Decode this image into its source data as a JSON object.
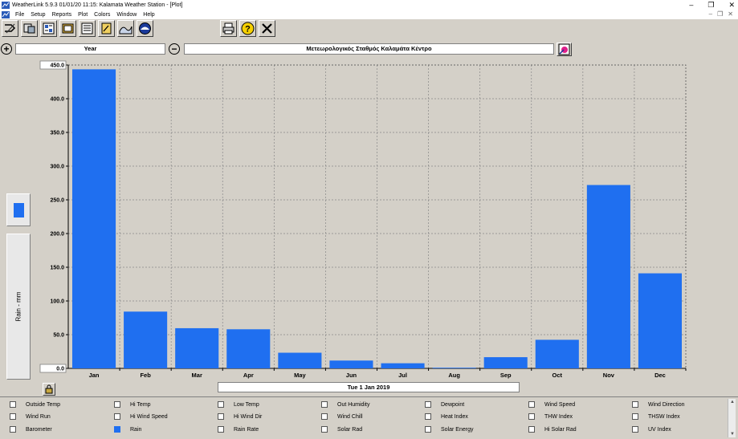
{
  "window": {
    "title": "WeatherLink 5.9.3  01/01/20  11:15: Kalamata Weather Station - [Plot]",
    "controls": [
      "–",
      "❐",
      "✕"
    ],
    "mdi_controls": [
      "–",
      "❐",
      "✕"
    ]
  },
  "menu": [
    "File",
    "Setup",
    "Reports",
    "Plot",
    "Colors",
    "Window",
    "Help"
  ],
  "toolbar": {
    "left_icons": [
      "connect-icon",
      "walk-icon",
      "summary-icon",
      "monitor-icon",
      "browse-icon",
      "notes-icon",
      "plot-icon",
      "noaa-icon"
    ],
    "right_icons": [
      "print-icon",
      "help-icon",
      "close-icon"
    ]
  },
  "selector": {
    "zoom_in": "+",
    "period": "Year",
    "zoom_out": "−",
    "station_name": "Μετεωρολογικός Σταθμός Καλαμάτα Κέντρο"
  },
  "date_label": "Tue 1 Jan 2019",
  "colors": {
    "bar": "#1f6ff0",
    "grid": "#888888"
  },
  "chart_data": {
    "type": "bar",
    "categories": [
      "Jan",
      "Feb",
      "Mar",
      "Apr",
      "May",
      "Jun",
      "Jul",
      "Aug",
      "Sep",
      "Oct",
      "Nov",
      "Dec"
    ],
    "series": [
      {
        "name": "Rain",
        "values": [
          443.6,
          84.2,
          59.6,
          58.0,
          23.2,
          11.6,
          7.6,
          1.0,
          16.6,
          42.4,
          272.0,
          141.0
        ]
      }
    ],
    "ylabel": "Rain - mm",
    "ylim": [
      0,
      450
    ],
    "yticks": [
      "0.0",
      "50.0",
      "100.0",
      "150.0",
      "200.0",
      "250.0",
      "300.0",
      "350.0",
      "400.0",
      "450.0"
    ],
    "grid": true
  },
  "checkboxes": [
    {
      "label": "Outside Temp",
      "checked": false
    },
    {
      "label": "Hi Temp",
      "checked": false
    },
    {
      "label": "Low Temp",
      "checked": false
    },
    {
      "label": "Out Humidity",
      "checked": false
    },
    {
      "label": "Dewpoint",
      "checked": false
    },
    {
      "label": "Wind Speed",
      "checked": false
    },
    {
      "label": "Wind Direction",
      "checked": false
    },
    {
      "label": "Wind Run",
      "checked": false
    },
    {
      "label": "Hi Wind Speed",
      "checked": false
    },
    {
      "label": "Hi Wind Dir",
      "checked": false
    },
    {
      "label": "Wind Chill",
      "checked": false
    },
    {
      "label": "Heat Index",
      "checked": false
    },
    {
      "label": "THW Index",
      "checked": false
    },
    {
      "label": "THSW Index",
      "checked": false
    },
    {
      "label": "Barometer",
      "checked": false
    },
    {
      "label": "Rain",
      "checked": true
    },
    {
      "label": "Rain Rate",
      "checked": false
    },
    {
      "label": "Solar Rad",
      "checked": false
    },
    {
      "label": "Solar Energy",
      "checked": false
    },
    {
      "label": "Hi Solar Rad",
      "checked": false
    },
    {
      "label": "UV Index",
      "checked": false
    }
  ]
}
